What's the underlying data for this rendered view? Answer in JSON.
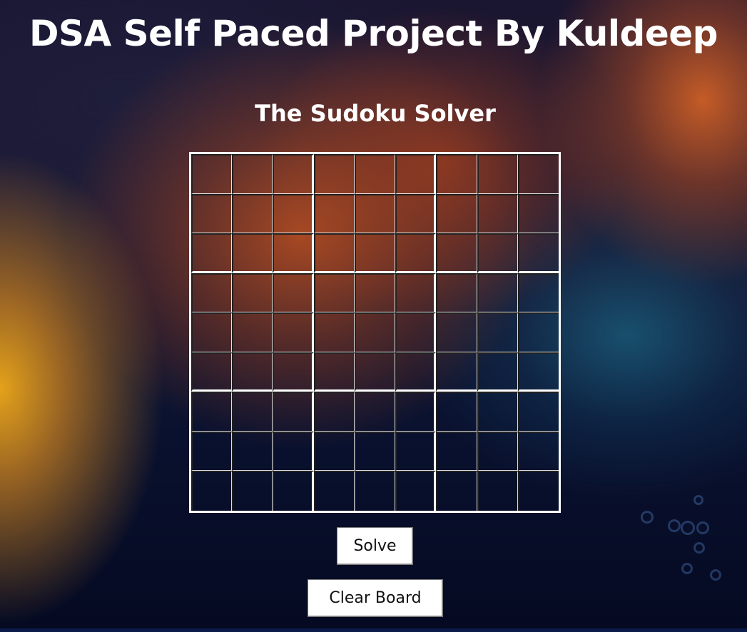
{
  "header": {
    "title": "DSA Self Paced Project By Kuldeep"
  },
  "solver": {
    "title": "The Sudoku Solver",
    "grid_rows": 9,
    "grid_cols": 9,
    "cell_values": [
      [
        "",
        "",
        "",
        "",
        "",
        "",
        "",
        "",
        ""
      ],
      [
        "",
        "",
        "",
        "",
        "",
        "",
        "",
        "",
        ""
      ],
      [
        "",
        "",
        "",
        "",
        "",
        "",
        "",
        "",
        ""
      ],
      [
        "",
        "",
        "",
        "",
        "",
        "",
        "",
        "",
        ""
      ],
      [
        "",
        "",
        "",
        "",
        "",
        "",
        "",
        "",
        ""
      ],
      [
        "",
        "",
        "",
        "",
        "",
        "",
        "",
        "",
        ""
      ],
      [
        "",
        "",
        "",
        "",
        "",
        "",
        "",
        "",
        ""
      ],
      [
        "",
        "",
        "",
        "",
        "",
        "",
        "",
        "",
        ""
      ],
      [
        "",
        "",
        "",
        "",
        "",
        "",
        "",
        "",
        ""
      ]
    ]
  },
  "actions": {
    "solve_label": "Solve",
    "clear_label": "Clear Board"
  },
  "colors": {
    "text": "#ffffff",
    "grid_line": "#ffffff",
    "button_bg": "#ffffff",
    "button_text": "#111111"
  }
}
